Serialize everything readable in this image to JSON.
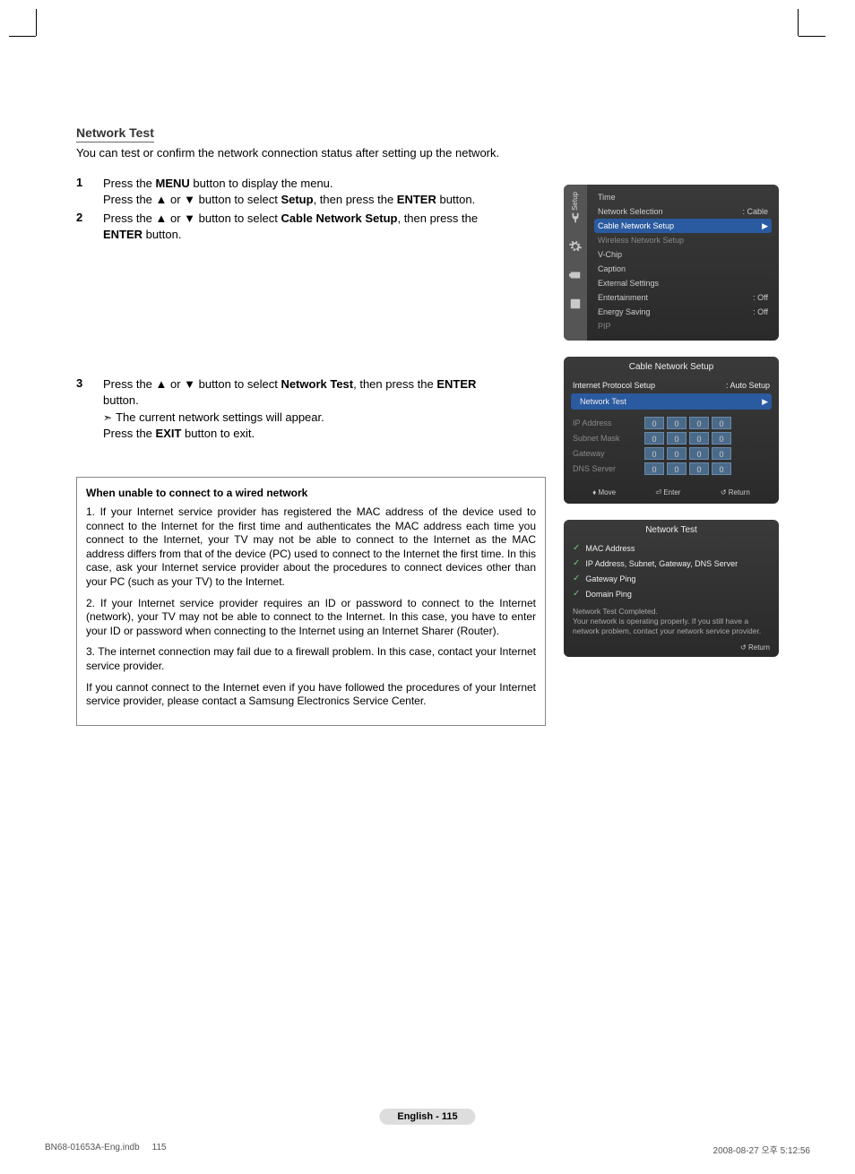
{
  "title": "Network Test",
  "intro": "You can test or confirm the network connection status after setting up the network.",
  "steps": {
    "s1": {
      "num": "1",
      "line1a": "Press the ",
      "line1b_bold": "MENU",
      "line1c": " button to display the menu.",
      "line2a": "Press the ▲ or ▼ button to select ",
      "line2b_bold": "Setup",
      "line2c": ", then press the ",
      "line2d_bold": "ENTER",
      "line2e": " button."
    },
    "s2": {
      "num": "2",
      "line1a": "Press the ▲ or ▼ button to select ",
      "line1b_bold": "Cable Network Setup",
      "line1c": ", then press the ",
      "line2a_bold": "ENTER",
      "line2b": " button."
    },
    "s3": {
      "num": "3",
      "line1a": "Press the ▲ or ▼ button to select ",
      "line1b_bold": "Network Test",
      "line1c": ", then press the ",
      "line1d_bold": "ENTER",
      "line2a": "button.",
      "note": "The current network settings will appear.",
      "exit_a": "Press the ",
      "exit_b_bold": "EXIT",
      "exit_c": " button to exit."
    }
  },
  "box": {
    "title": "When unable to connect to a wired network",
    "i1": "If your Internet service provider has registered the MAC address of the device used to connect to the Internet for the first time and authenticates the MAC address each time you connect to the Internet, your TV may not be able to connect to the Internet as the MAC address differs from that of the device (PC) used to connect to the Internet the first time. In this case, ask your Internet service provider about the procedures to connect devices other than your PC (such as your TV) to the Internet.",
    "i2": "If your Internet service provider requires an ID or password to connect to the Internet (network), your TV may not be able to connect to the Internet. In this case, you have to enter your ID or password when connecting to the Internet using an Internet Sharer (Router).",
    "i3": "The internet connection may fail due to a firewall problem. In this case, contact your Internet service provider.",
    "footer": "If you cannot connect to the Internet even if you have followed the procedures of your Internet service provider, please contact a Samsung Electronics Service Center."
  },
  "osd1": {
    "tab": "Setup",
    "rows": {
      "time": "Time",
      "netsel": "Network Selection",
      "netsel_val": ": Cable",
      "cable": "Cable Network Setup",
      "wireless": "Wireless Network Setup",
      "vchip": "V-Chip",
      "caption": "Caption",
      "external": "External Settings",
      "entertainment": "Entertainment",
      "entertainment_val": ": Off",
      "energy": "Energy Saving",
      "energy_val": ": Off",
      "pip": "PIP"
    }
  },
  "osd2": {
    "title": "Cable Network Setup",
    "ips": "Internet Protocol Setup",
    "ips_val": ": Auto Setup",
    "nettest": "Network Test",
    "ip": "IP Address",
    "subnet": "Subnet Mask",
    "gateway": "Gateway",
    "dns": "DNS Server",
    "cell": "0",
    "foot_move": "Move",
    "foot_enter": "Enter",
    "foot_return": "Return"
  },
  "osd3": {
    "title": "Network Test",
    "mac": "MAC Address",
    "ip": "IP Address, Subnet, Gateway, DNS Server",
    "gping": "Gateway Ping",
    "dping": "Domain Ping",
    "msg": "Network Test Completed.\nYour network is operating properly. If you still have a network problem, contact your network service provider.",
    "foot_return": "Return"
  },
  "page_footer": "English - 115",
  "doc_footer": {
    "file": "BN68-01653A-Eng.indb",
    "page": "115",
    "datetime": "2008-08-27   오후 5:12:56"
  }
}
